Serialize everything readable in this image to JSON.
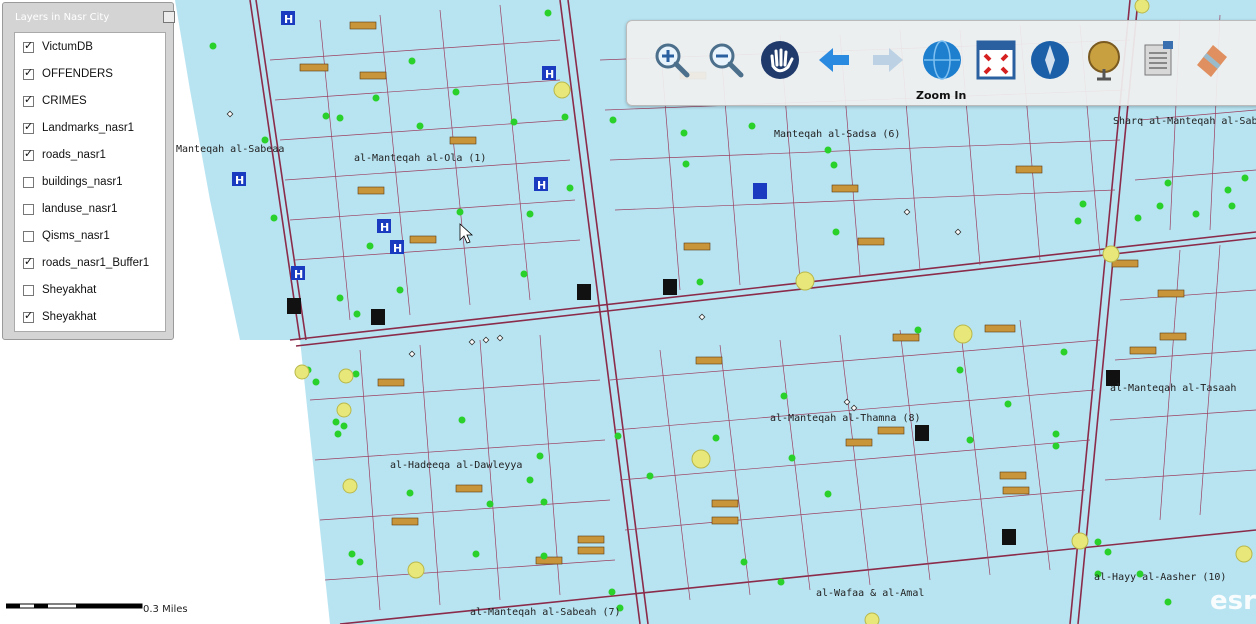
{
  "layers_panel": {
    "title": "Layers in Nasr City",
    "items": [
      {
        "label": "VictumDB",
        "checked": true
      },
      {
        "label": "OFFENDERS",
        "checked": true
      },
      {
        "label": "CRIMES",
        "checked": true
      },
      {
        "label": "Landmarks_nasr1",
        "checked": true
      },
      {
        "label": "roads_nasr1",
        "checked": true
      },
      {
        "label": "buildings_nasr1",
        "checked": false
      },
      {
        "label": "landuse_nasr1",
        "checked": false
      },
      {
        "label": "Qisms_nasr1",
        "checked": false
      },
      {
        "label": "roads_nasr1_Buffer1",
        "checked": true
      },
      {
        "label": "Sheyakhat",
        "checked": false
      },
      {
        "label": "Sheyakhat",
        "checked": true
      }
    ]
  },
  "toolbar": {
    "tools": [
      {
        "name": "zoom-in",
        "icon": "magnifier-plus-icon"
      },
      {
        "name": "zoom-out",
        "icon": "magnifier-minus-icon"
      },
      {
        "name": "pan",
        "icon": "hand-icon"
      },
      {
        "name": "previous-extent",
        "icon": "arrow-left-icon"
      },
      {
        "name": "next-extent",
        "icon": "arrow-right-icon"
      },
      {
        "name": "full-extent",
        "icon": "globe-icon"
      },
      {
        "name": "zoom-to-window",
        "icon": "expand-arrows-icon"
      },
      {
        "name": "identify",
        "icon": "globe-info-icon"
      },
      {
        "name": "measure",
        "icon": "globe-magnifier-icon"
      },
      {
        "name": "print",
        "icon": "printer-icon"
      },
      {
        "name": "clear",
        "icon": "eraser-icon"
      }
    ],
    "tooltip": "Zoom In"
  },
  "map": {
    "labels": [
      "Manteqah al-Sadsa (6)",
      "Sharq al-Manteqah al-Sab",
      "Manteqah al-Sabeaa",
      "al-Manteqah al-Ola (1)",
      "al-Manteqah al-Tasaah",
      "al-Manteqah al-Thamna (8)",
      "al-Hadeeqa al-Dawleyya",
      "al-Hayy al-Aasher (10)",
      "al-Wafaa & al-Amal",
      "al-Manteqah al-Sabeah (7)"
    ],
    "colors": {
      "block": "#b8e4f2",
      "road": "#8b2b4a",
      "point": "#2bd12b",
      "parcel": "#c8953a"
    }
  },
  "scale_bar": {
    "label": "0.3 Miles"
  },
  "watermark": "esri"
}
